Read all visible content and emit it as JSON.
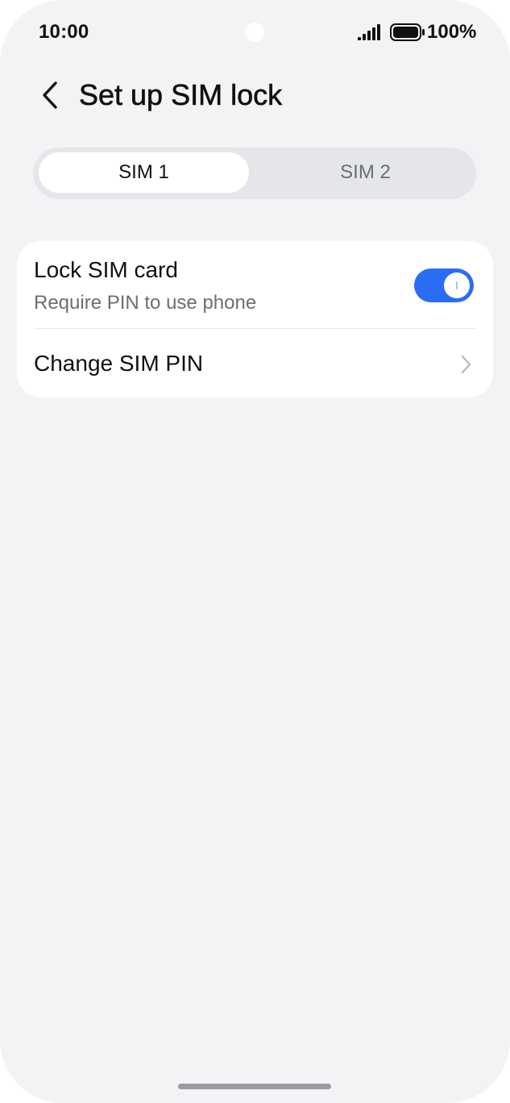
{
  "status_bar": {
    "time": "10:00",
    "battery_percent": "100%",
    "signal_icon": "signal-bars-icon",
    "battery_icon": "battery-full-icon"
  },
  "header": {
    "back_icon": "chevron-left-icon",
    "title": "Set up SIM lock"
  },
  "tabs": [
    {
      "label": "SIM 1",
      "selected": true
    },
    {
      "label": "SIM 2",
      "selected": false
    }
  ],
  "settings": {
    "lock_sim": {
      "title": "Lock SIM card",
      "subtitle": "Require PIN to use phone",
      "enabled": true
    },
    "change_pin": {
      "title": "Change SIM PIN",
      "icon": "chevron-right-icon"
    }
  },
  "colors": {
    "accent": "#2a6df4",
    "background": "#f2f3f5",
    "card": "#ffffff",
    "text_primary": "#111111",
    "text_secondary": "#6b6e73"
  }
}
